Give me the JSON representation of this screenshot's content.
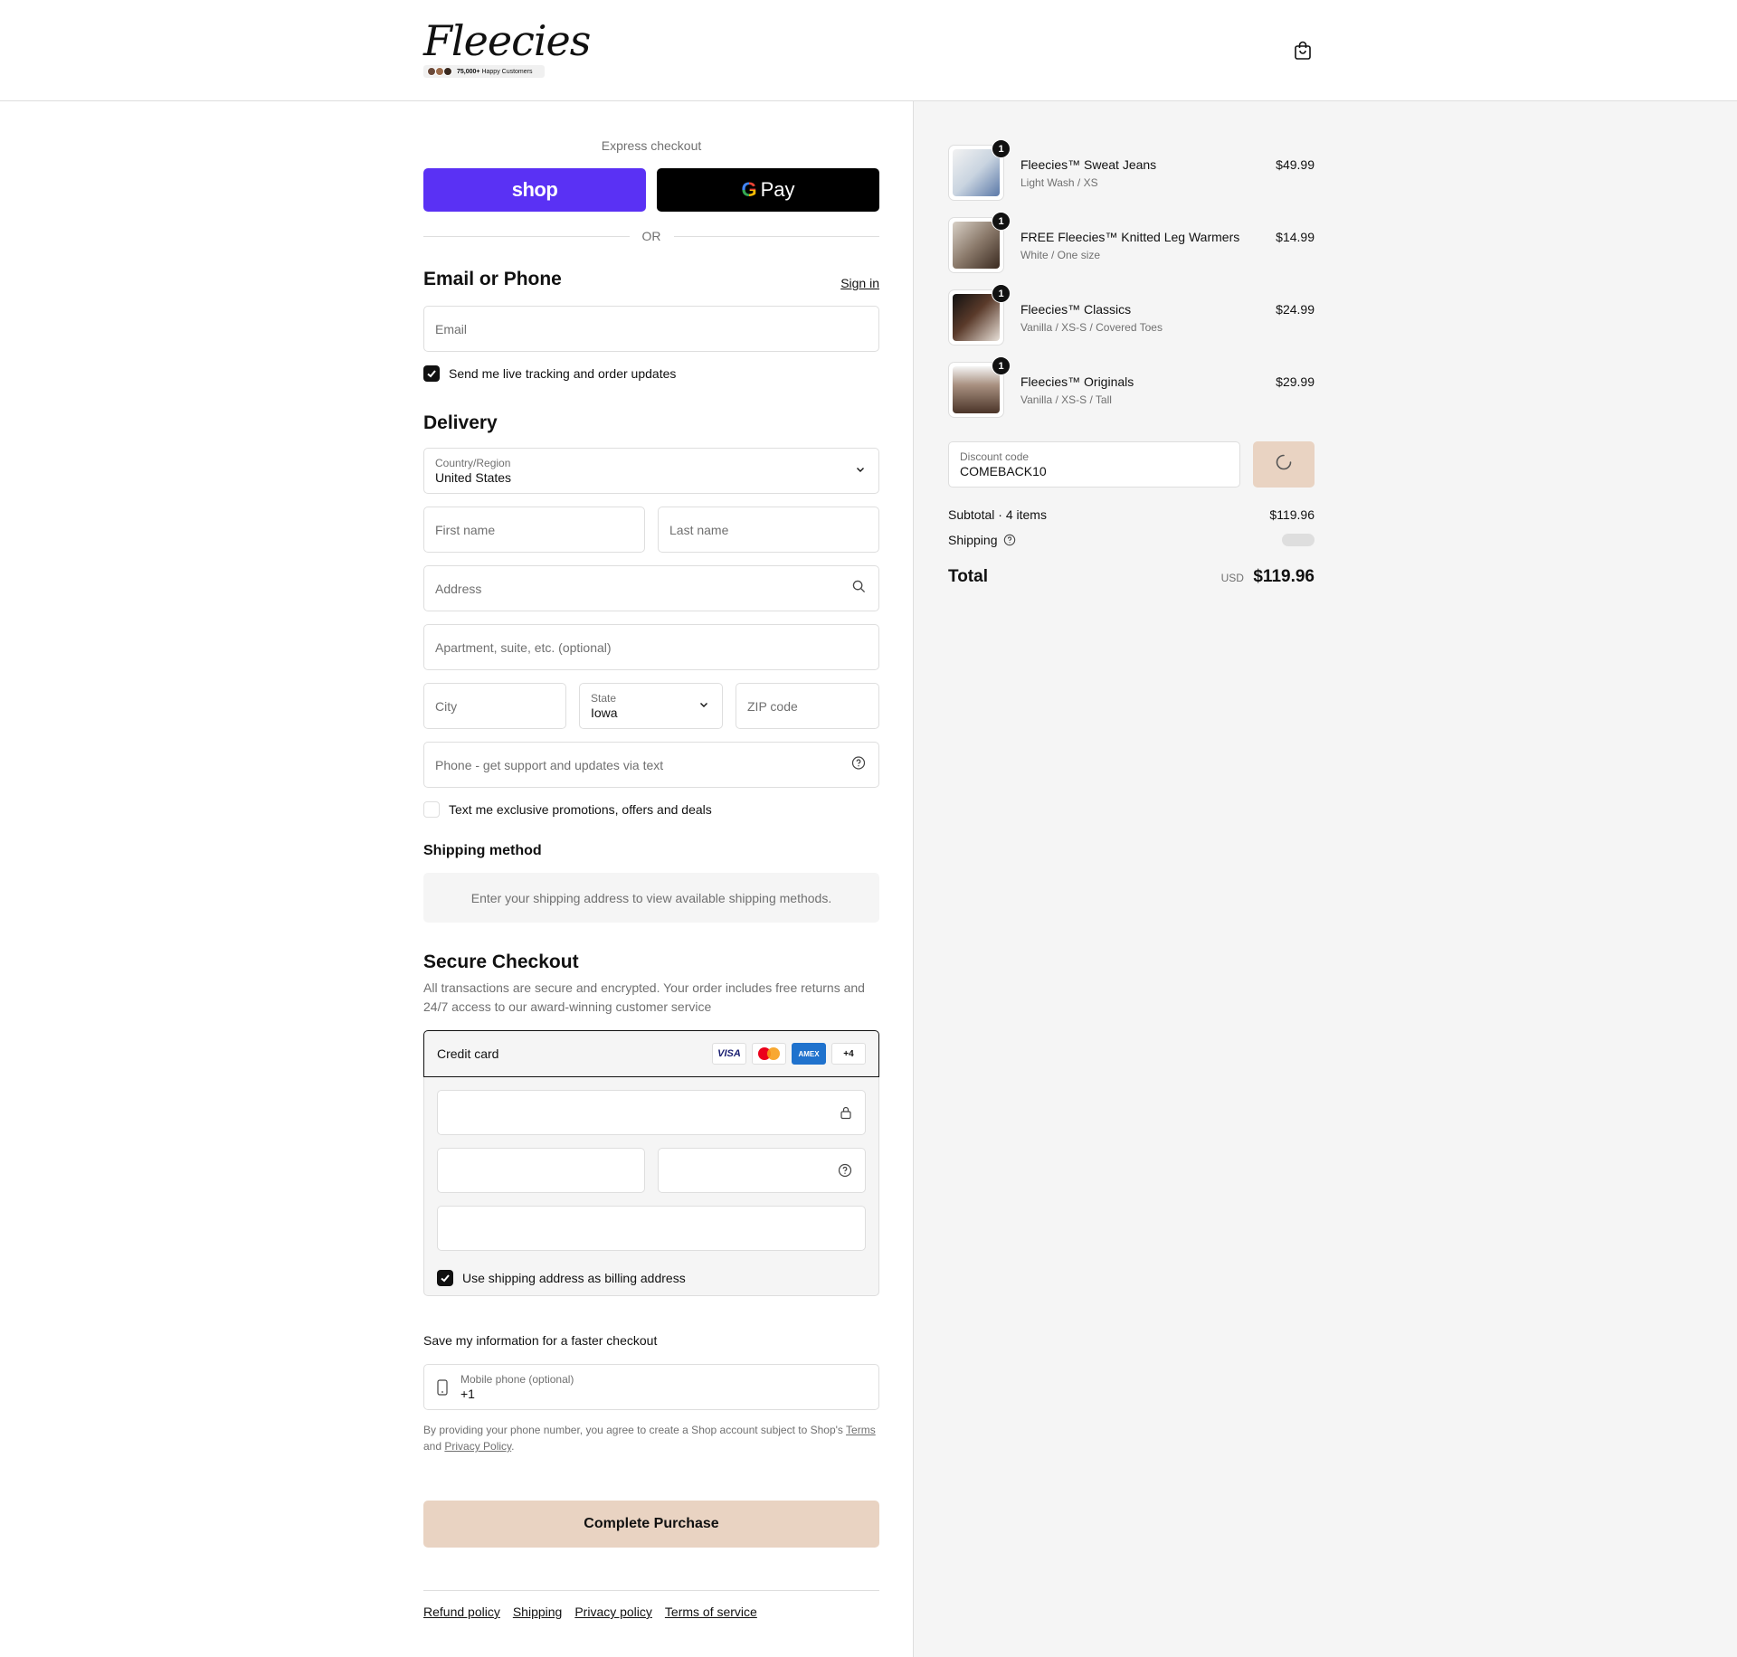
{
  "header": {
    "logo_text": "Fleecies",
    "logo_count": "75,000+",
    "logo_tagline": "Happy Customers"
  },
  "express": {
    "label": "Express checkout",
    "shop_pay": "shop",
    "gpay": "Pay",
    "or": "OR"
  },
  "contact": {
    "title": "Email or Phone",
    "sign_in": "Sign in",
    "email_placeholder": "Email",
    "tracking_label": "Send me live tracking and order updates",
    "tracking_checked": true
  },
  "delivery": {
    "title": "Delivery",
    "country_label": "Country/Region",
    "country_value": "United States",
    "first_name": "First name",
    "last_name": "Last name",
    "address": "Address",
    "apartment": "Apartment, suite, etc. (optional)",
    "city": "City",
    "state_label": "State",
    "state_value": "Iowa",
    "zip": "ZIP code",
    "phone": "Phone - get support and updates via text",
    "promo_label": "Text me exclusive promotions, offers and deals",
    "promo_checked": false
  },
  "shipping_method": {
    "title": "Shipping method",
    "note": "Enter your shipping address to view available shipping methods."
  },
  "payment": {
    "title": "Secure Checkout",
    "description": "All transactions are secure and encrypted. Your order includes free returns and 24/7 access to our award-winning customer service",
    "method_label": "Credit card",
    "card_visa": "VISA",
    "card_amex": "AMEX",
    "more_cards": "+4",
    "billing_label": "Use shipping address as billing address",
    "billing_checked": true
  },
  "save_info": {
    "label": "Save my information for a faster checkout",
    "phone_label": "Mobile phone (optional)",
    "phone_value": "+1",
    "legal_prefix": "By providing your phone number, you agree to create a Shop account subject to Shop's",
    "legal_terms": "Terms",
    "legal_and": "and",
    "legal_privacy": "Privacy Policy",
    "legal_end": "."
  },
  "complete_button": "Complete Purchase",
  "footer": {
    "links": [
      "Refund policy",
      "Shipping",
      "Privacy policy",
      "Terms of service"
    ]
  },
  "order": {
    "items": [
      {
        "name": "Fleecies™ Sweat Jeans",
        "variant": "Light Wash / XS",
        "price": "$49.99",
        "qty": "1",
        "thumb_color": "#c9d4e0"
      },
      {
        "name": "FREE Fleecies™ Knitted Leg Warmers",
        "variant": "White / One size",
        "price": "$14.99",
        "qty": "1",
        "thumb_color": "#8b7a6b"
      },
      {
        "name": "Fleecies™ Classics",
        "variant": "Vanilla / XS-S / Covered Toes",
        "price": "$24.99",
        "qty": "1",
        "thumb_color": "#5a3a2a"
      },
      {
        "name": "Fleecies™ Originals",
        "variant": "Vanilla / XS-S / Tall",
        "price": "$29.99",
        "qty": "1",
        "thumb_color": "#a89080"
      }
    ],
    "discount_label": "Discount code",
    "discount_value": "COMEBACK10",
    "subtotal_label": "Subtotal · 4 items",
    "subtotal_value": "$119.96",
    "shipping_label": "Shipping",
    "total_label": "Total",
    "total_currency": "USD",
    "total_value": "$119.96"
  },
  "colors": {
    "shop_pay": "#5a31f4",
    "accent_button": "#e9d3c2",
    "panel_bg": "#f5f5f5"
  }
}
